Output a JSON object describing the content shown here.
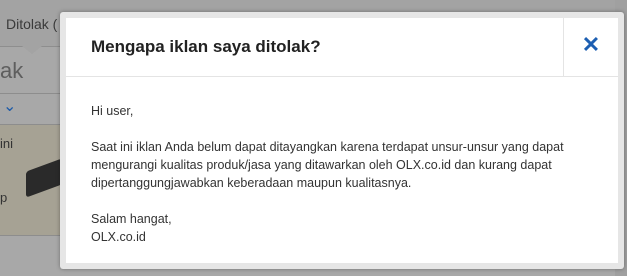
{
  "background": {
    "tab_label": "Ditolak (",
    "heading": "ak",
    "row_text_top": "ini",
    "row_text_bottom": "p",
    "chevron_glyph": "⌄"
  },
  "modal": {
    "title": "Mengapa iklan saya ditolak?",
    "close_glyph": "✕",
    "greeting": "Hi user,",
    "body_line1": "Saat ini iklan Anda belum dapat ditayangkan karena terdapat unsur-unsur yang dapat",
    "body_line2": "mengurangi kualitas produk/jasa yang ditawarkan oleh OLX.co.id dan kurang dapat",
    "body_line3": "dipertanggungjawabkan keberadaan maupun kualitasnya.",
    "signoff": "Salam hangat,",
    "signature": "OLX.co.id"
  },
  "colors": {
    "accent": "#1d5fb2",
    "overlay": "#a8a8a8"
  }
}
